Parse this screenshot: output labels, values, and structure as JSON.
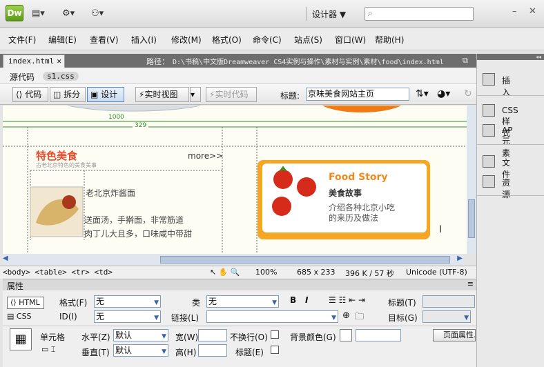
{
  "app": {
    "logo": "Dw",
    "workspace": "设计器 ▼",
    "search_placeholder": "⌕"
  },
  "menu": [
    "文件(F)",
    "编辑(E)",
    "查看(V)",
    "插入(I)",
    "修改(M)",
    "格式(O)",
    "命令(C)",
    "站点(S)",
    "窗口(W)",
    "帮助(H)"
  ],
  "doc": {
    "tab": "index.html",
    "path_label": "路径：",
    "path": "D:\\书稿\\中文版Dreamweaver CS4实例与操作\\素材与实例\\素材\\food\\index.html",
    "related": [
      "源代码",
      "s1.css"
    ]
  },
  "toolbar": {
    "code": "代码",
    "split": "拆分",
    "design": "设计",
    "live_view": "实时视图",
    "live_code": "实时代码",
    "title_label": "标题:",
    "title_value": "京味美食网站主页"
  },
  "canvas": {
    "width1000": "1000",
    "width329": "329",
    "section_title": "特色美食",
    "section_sub": "古老北京特色的美食美事",
    "more": "more>>",
    "item_title": "老北京炸酱面",
    "item_line1": "送面汤，手擀面，非常筋道",
    "item_line2": "肉丁儿大且多，口味咸中带甜",
    "banner_en": "Food Story",
    "banner_cn": "美食故事",
    "banner_l1": "介绍各种北京小吃",
    "banner_l2": "的来历及做法"
  },
  "status": {
    "tags": "<body> <table> <tr> <td>",
    "zoom": "100%",
    "size": "685 x 233",
    "weight": "396 K / 57 秒",
    "encoding": "Unicode (UTF-8)"
  },
  "props": {
    "title": "属性",
    "html_btn": "HTML",
    "css_btn": "CSS",
    "format_label": "格式(F)",
    "format_value": "无",
    "id_label": "ID(I)",
    "id_value": "无",
    "class_label": "类",
    "class_value": "无",
    "link_label": "链接(L)",
    "title_label": "标题(T)",
    "target_label": "目标(G)",
    "cell_label": "单元格",
    "halign_label": "水平(Z)",
    "halign_value": "默认",
    "valign_label": "垂直(T)",
    "valign_value": "默认",
    "width_label": "宽(W)",
    "height_label": "高(H)",
    "nowrap_label": "不换行(O)",
    "header_label": "标题(E)",
    "bg_label": "背景颜色(G)",
    "page_props": "页面属性..."
  },
  "panels": {
    "insert": "插入",
    "css": "CSS样式",
    "ap": "AP 元素",
    "files": "文件",
    "assets": "资源"
  },
  "colors": {
    "accent": "#e84b2c",
    "banner_orange": "#f5a623",
    "guide_green": "#2a8f2a"
  }
}
